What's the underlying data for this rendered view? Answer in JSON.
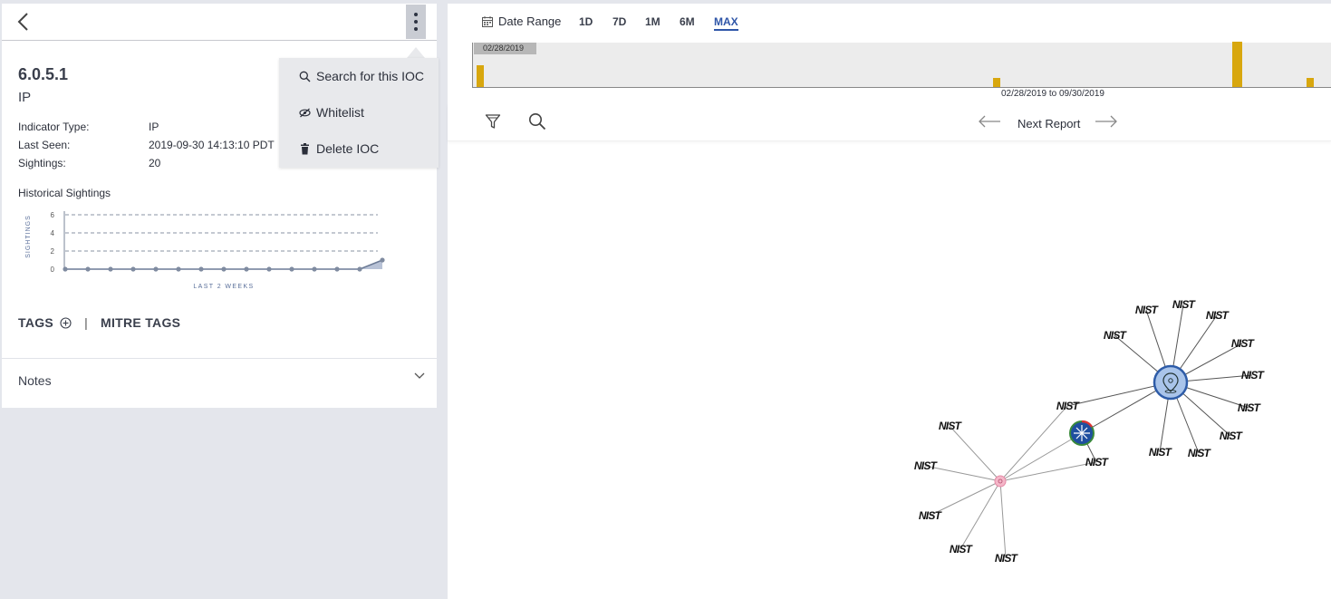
{
  "indicator": {
    "title": "6.0.5.1",
    "subtitle": "IP",
    "fields": [
      {
        "label": "Indicator Type:",
        "value": "IP"
      },
      {
        "label": "Last Seen:",
        "value": "2019-09-30 14:13:10 PDT"
      },
      {
        "label": "Sightings:",
        "value": "20"
      }
    ]
  },
  "historical": {
    "label": "Historical Sightings",
    "y_axis_label": "SIGHTINGS",
    "x_axis_label": "LAST 2 WEEKS",
    "y_ticks": [
      "6",
      "4",
      "2",
      "0"
    ]
  },
  "chart_data": {
    "type": "line",
    "title": "Historical Sightings",
    "xlabel": "LAST 2 WEEKS",
    "ylabel": "SIGHTINGS",
    "ylim": [
      0,
      6
    ],
    "values": [
      0,
      0,
      0,
      0,
      0,
      0,
      0,
      0,
      0,
      0,
      0,
      0,
      0,
      0,
      1
    ]
  },
  "tags": {
    "label": "TAGS",
    "separator": "|",
    "mitre_label": "MITRE TAGS"
  },
  "notes": {
    "label": "Notes"
  },
  "menu": {
    "items": [
      {
        "label": "Search for this IOC",
        "icon": "search-icon"
      },
      {
        "label": "Whitelist",
        "icon": "eye-slash-icon"
      },
      {
        "label": "Delete IOC",
        "icon": "trash-icon"
      }
    ]
  },
  "toolbar": {
    "date_range_label": "Date Range",
    "ranges": [
      "1D",
      "7D",
      "1M",
      "6M",
      "MAX"
    ],
    "active_range": "MAX"
  },
  "timeline": {
    "start_label": "02/28/2019",
    "range_label": "02/28/2019 to 09/30/2019",
    "bars": [
      {
        "pos": 0.004,
        "value": 0.48
      },
      {
        "pos": 0.607,
        "value": 0.2
      },
      {
        "pos": 0.886,
        "value": 1.0
      },
      {
        "pos": 0.972,
        "value": 0.2
      }
    ],
    "bar_color": "#d8a70e"
  },
  "nav": {
    "next_report_label": "Next Report"
  },
  "graph": {
    "node_label": "NIST",
    "colors": {
      "hub": "#a9c4ea",
      "hub_border": "#2e5ca8",
      "pink": "#f4b6c8",
      "star": "#1f4fa0"
    }
  }
}
